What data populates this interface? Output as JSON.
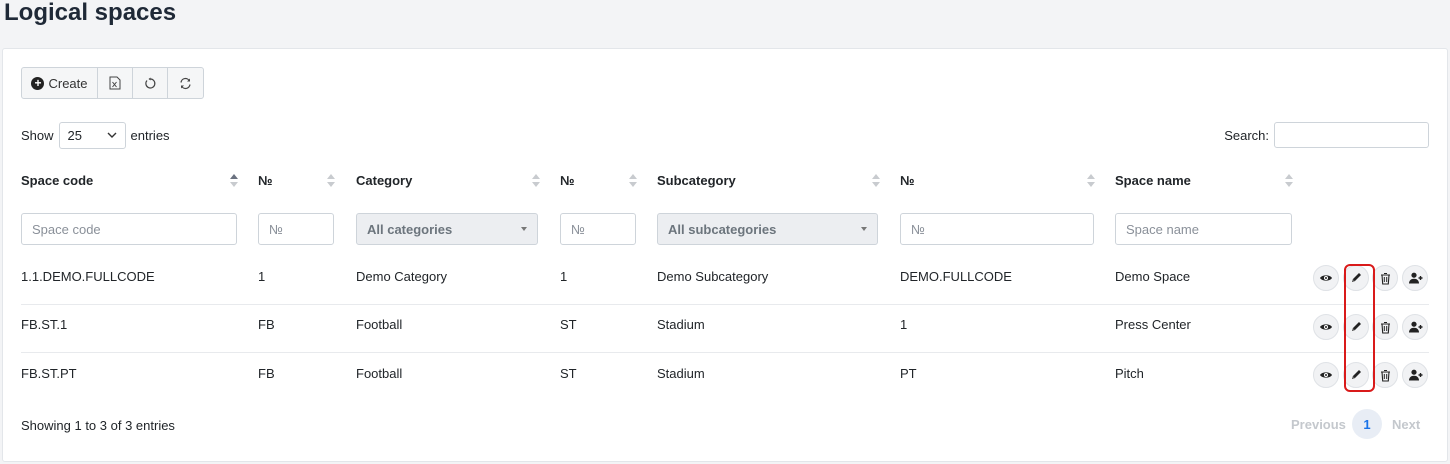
{
  "page": {
    "title": "Logical spaces"
  },
  "toolbar": {
    "create_label": "Create",
    "icons": [
      "plus-circle-icon",
      "excel-icon",
      "reset-icon",
      "refresh-icon"
    ]
  },
  "length": {
    "show_label": "Show",
    "value": "25",
    "entries_label": "entries"
  },
  "search": {
    "label": "Search:",
    "value": ""
  },
  "columns": [
    {
      "label": "Space code",
      "sorted": "asc"
    },
    {
      "label": "№"
    },
    {
      "label": "Category"
    },
    {
      "label": "№"
    },
    {
      "label": "Subcategory"
    },
    {
      "label": "№"
    },
    {
      "label": "Space name"
    }
  ],
  "filters": {
    "space_code_placeholder": "Space code",
    "num1_placeholder": "№",
    "category_value": "All categories",
    "num2_placeholder": "№",
    "subcategory_value": "All subcategories",
    "num3_placeholder": "№",
    "space_name_placeholder": "Space name"
  },
  "rows": [
    [
      "1.1.DEMO.FULLCODE",
      "1",
      "Demo Category",
      "1",
      "Demo Subcategory",
      "DEMO.FULLCODE",
      "Demo Space"
    ],
    [
      "FB.ST.1",
      "FB",
      "Football",
      "ST",
      "Stadium",
      "1",
      "Press Center"
    ],
    [
      "FB.ST.PT",
      "FB",
      "Football",
      "ST",
      "Stadium",
      "PT",
      "Pitch"
    ]
  ],
  "row_actions": [
    "eye-icon",
    "pencil-icon",
    "trash-icon",
    "user-plus-icon"
  ],
  "info": "Showing 1 to 3 of 3 entries",
  "pagination": {
    "previous": "Previous",
    "page": "1",
    "next": "Next"
  },
  "colors": {
    "highlight": "#d91a1a",
    "active_page": "#1a73e8"
  }
}
